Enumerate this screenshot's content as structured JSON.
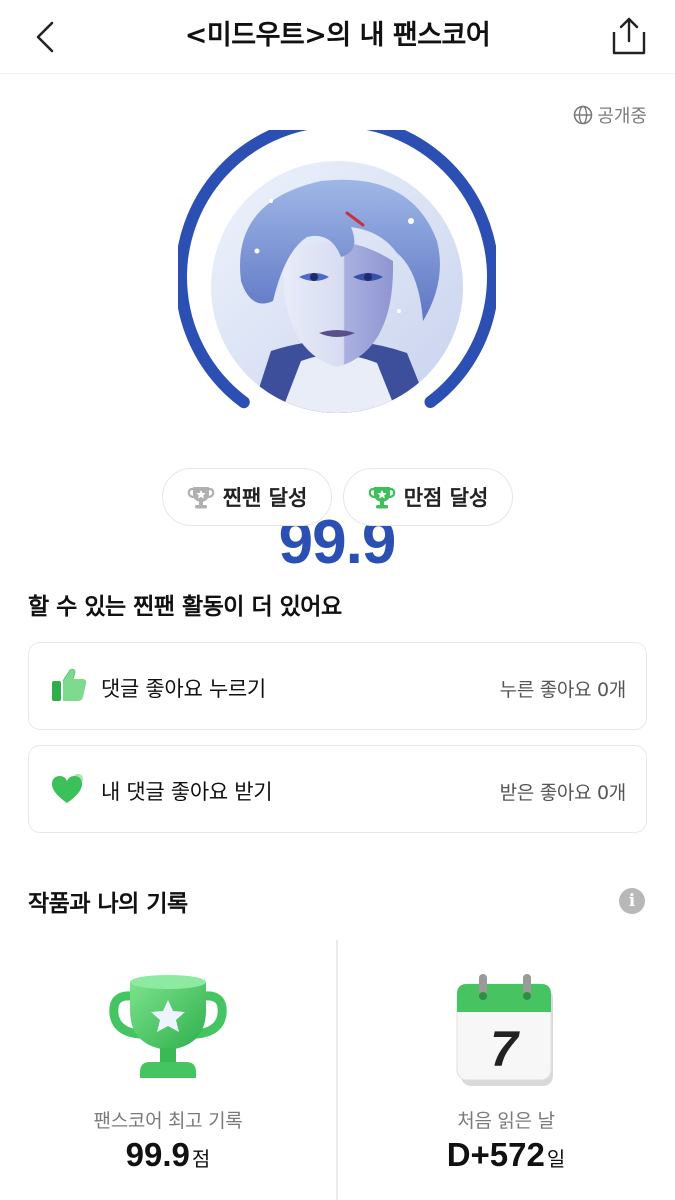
{
  "header": {
    "title": "<미드우트>의 내 팬스코어",
    "back_icon": "chevron-left-icon",
    "share_icon": "share-icon"
  },
  "visibility": {
    "label": "공개중",
    "icon": "globe-icon"
  },
  "score": {
    "value": "99.9",
    "progress_fraction": 0.999,
    "color": "#2c4fb4",
    "avatar": "comic-character-avatar"
  },
  "achievements": [
    {
      "label": "찐팬 달성",
      "icon": "trophy-icon",
      "color": "#b0b0b0"
    },
    {
      "label": "만점 달성",
      "icon": "trophy-icon",
      "color": "#3cc15a"
    }
  ],
  "activities": {
    "title": "할 수 있는 찐팬 활동이 더 있어요",
    "items": [
      {
        "label": "댓글 좋아요 누르기",
        "value": "누른 좋아요 0개",
        "icon": "thumbs-up-icon"
      },
      {
        "label": "내 댓글 좋아요 받기",
        "value": "받은 좋아요 0개",
        "icon": "heart-icon"
      }
    ]
  },
  "records": {
    "title": "작품과 나의 기록",
    "info_icon": "info-icon",
    "items": [
      {
        "label": "팬스코어 최고 기록",
        "value": "99.9",
        "unit": "점",
        "icon": "trophy-icon"
      },
      {
        "label": "처음 읽은 날",
        "value": "D+572",
        "unit": "일",
        "icon": "calendar-icon",
        "calendar_day": "7"
      }
    ]
  },
  "colors": {
    "accent_blue": "#2c4fb4",
    "green": "#3cc15a"
  }
}
